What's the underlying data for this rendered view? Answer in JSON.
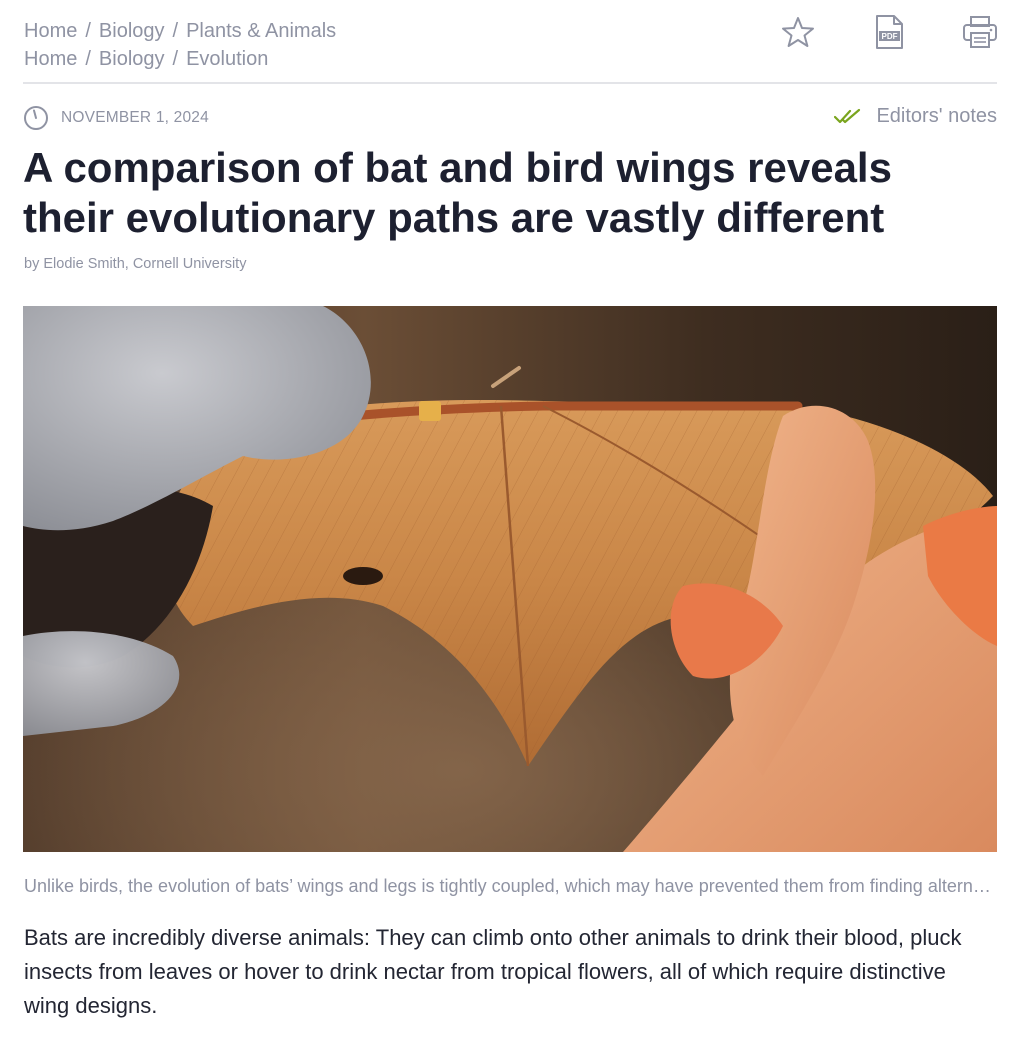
{
  "breadcrumbs": [
    {
      "items": [
        "Home",
        "Biology",
        "Plants & Animals"
      ]
    },
    {
      "items": [
        "Home",
        "Biology",
        "Evolution"
      ]
    }
  ],
  "breadcrumb_separator": "/",
  "toolbar": {
    "bookmark_icon": "star-icon",
    "pdf_icon": "pdf-icon",
    "pdf_label": "PDF",
    "print_icon": "printer-icon"
  },
  "meta": {
    "date": "NOVEMBER 1, 2024",
    "date_icon": "clock-icon",
    "editors_notes": "Editors' notes",
    "editors_notes_icon": "double-check-icon"
  },
  "article": {
    "title": "A comparison of bat and bird wings reveals their evolutionary paths are vastly different",
    "byline_prefix": "by",
    "author": "Elodie Smith",
    "affiliation": "Cornell University",
    "caption": "Unlike birds, the evolution of bats’ wings and legs is tightly coupled, which may have prevented them from finding alternative ways to adapt to different niches.",
    "body": "Bats are incredibly diverse animals: They can climb onto other animals to drink their blood, pluck insects from leaves or hover to drink nectar from tropical flowers, all of which require distinctive wing designs."
  },
  "colors": {
    "muted_text": "#8f93a3",
    "title_text": "#1d2030",
    "check_accent": "#7aa51e",
    "divider": "#e3e4e8"
  }
}
